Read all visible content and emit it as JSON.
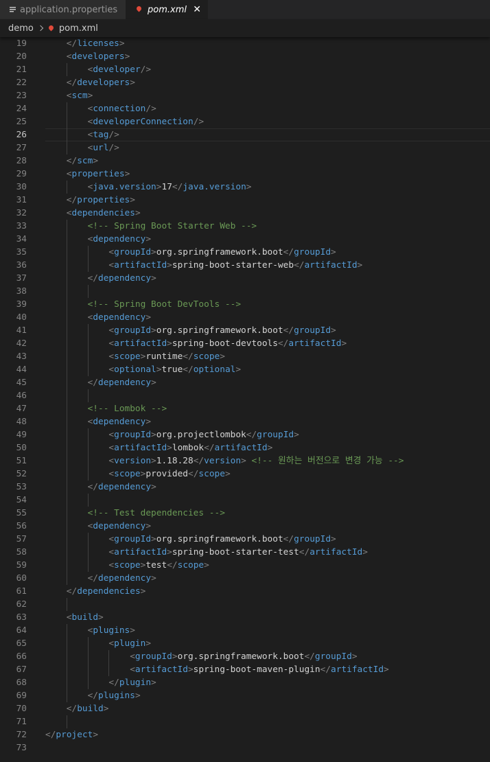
{
  "tabs": [
    {
      "label": "application.properties",
      "icon": "lines-icon",
      "active": false
    },
    {
      "label": "pom.xml",
      "icon": "xml-pin-icon",
      "active": true,
      "close": "✕"
    }
  ],
  "breadcrumb": {
    "folder": "demo",
    "file": "pom.xml"
  },
  "editor": {
    "current_line": 26,
    "colors": {
      "background": "#1e1e1e",
      "tag": "#569cd6",
      "punctuation": "#808080",
      "text": "#d4d4d4",
      "comment": "#6a9955",
      "line_number": "#858585"
    },
    "lines": [
      {
        "n": "19",
        "indent": 1,
        "tokens": [
          [
            "p",
            "</"
          ],
          [
            "t",
            "licenses"
          ],
          [
            "p",
            ">"
          ]
        ]
      },
      {
        "n": "20",
        "indent": 1,
        "tokens": [
          [
            "p",
            "<"
          ],
          [
            "t",
            "developers"
          ],
          [
            "p",
            ">"
          ]
        ]
      },
      {
        "n": "21",
        "indent": 2,
        "tokens": [
          [
            "p",
            "<"
          ],
          [
            "t",
            "developer"
          ],
          [
            "p",
            "/>"
          ]
        ]
      },
      {
        "n": "22",
        "indent": 1,
        "tokens": [
          [
            "p",
            "</"
          ],
          [
            "t",
            "developers"
          ],
          [
            "p",
            ">"
          ]
        ]
      },
      {
        "n": "23",
        "indent": 1,
        "tokens": [
          [
            "p",
            "<"
          ],
          [
            "t",
            "scm"
          ],
          [
            "p",
            ">"
          ]
        ]
      },
      {
        "n": "24",
        "indent": 2,
        "tokens": [
          [
            "p",
            "<"
          ],
          [
            "t",
            "connection"
          ],
          [
            "p",
            "/>"
          ]
        ]
      },
      {
        "n": "25",
        "indent": 2,
        "tokens": [
          [
            "p",
            "<"
          ],
          [
            "t",
            "developerConnection"
          ],
          [
            "p",
            "/>"
          ]
        ]
      },
      {
        "n": "26",
        "indent": 2,
        "tokens": [
          [
            "p",
            "<"
          ],
          [
            "t",
            "tag"
          ],
          [
            "p",
            "/>"
          ]
        ]
      },
      {
        "n": "27",
        "indent": 2,
        "tokens": [
          [
            "p",
            "<"
          ],
          [
            "t",
            "url"
          ],
          [
            "p",
            "/>"
          ]
        ]
      },
      {
        "n": "28",
        "indent": 1,
        "tokens": [
          [
            "p",
            "</"
          ],
          [
            "t",
            "scm"
          ],
          [
            "p",
            ">"
          ]
        ]
      },
      {
        "n": "29",
        "indent": 1,
        "tokens": [
          [
            "p",
            "<"
          ],
          [
            "t",
            "properties"
          ],
          [
            "p",
            ">"
          ]
        ]
      },
      {
        "n": "30",
        "indent": 2,
        "tokens": [
          [
            "p",
            "<"
          ],
          [
            "t",
            "java.version"
          ],
          [
            "p",
            ">"
          ],
          [
            "x",
            "17"
          ],
          [
            "p",
            "</"
          ],
          [
            "t",
            "java.version"
          ],
          [
            "p",
            ">"
          ]
        ]
      },
      {
        "n": "31",
        "indent": 1,
        "tokens": [
          [
            "p",
            "</"
          ],
          [
            "t",
            "properties"
          ],
          [
            "p",
            ">"
          ]
        ]
      },
      {
        "n": "32",
        "indent": 1,
        "tokens": [
          [
            "p",
            "<"
          ],
          [
            "t",
            "dependencies"
          ],
          [
            "p",
            ">"
          ]
        ]
      },
      {
        "n": "33",
        "indent": 2,
        "tokens": [
          [
            "c",
            "<!-- Spring Boot Starter Web -->"
          ]
        ]
      },
      {
        "n": "34",
        "indent": 2,
        "tokens": [
          [
            "p",
            "<"
          ],
          [
            "t",
            "dependency"
          ],
          [
            "p",
            ">"
          ]
        ]
      },
      {
        "n": "35",
        "indent": 3,
        "tokens": [
          [
            "p",
            "<"
          ],
          [
            "t",
            "groupId"
          ],
          [
            "p",
            ">"
          ],
          [
            "x",
            "org.springframework.boot"
          ],
          [
            "p",
            "</"
          ],
          [
            "t",
            "groupId"
          ],
          [
            "p",
            ">"
          ]
        ]
      },
      {
        "n": "36",
        "indent": 3,
        "tokens": [
          [
            "p",
            "<"
          ],
          [
            "t",
            "artifactId"
          ],
          [
            "p",
            ">"
          ],
          [
            "x",
            "spring-boot-starter-web"
          ],
          [
            "p",
            "</"
          ],
          [
            "t",
            "artifactId"
          ],
          [
            "p",
            ">"
          ]
        ]
      },
      {
        "n": "37",
        "indent": 2,
        "tokens": [
          [
            "p",
            "</"
          ],
          [
            "t",
            "dependency"
          ],
          [
            "p",
            ">"
          ]
        ]
      },
      {
        "n": "38",
        "indent": 0,
        "guides": 2,
        "tokens": []
      },
      {
        "n": "39",
        "indent": 2,
        "tokens": [
          [
            "c",
            "<!-- Spring Boot DevTools -->"
          ]
        ]
      },
      {
        "n": "40",
        "indent": 2,
        "tokens": [
          [
            "p",
            "<"
          ],
          [
            "t",
            "dependency"
          ],
          [
            "p",
            ">"
          ]
        ]
      },
      {
        "n": "41",
        "indent": 3,
        "tokens": [
          [
            "p",
            "<"
          ],
          [
            "t",
            "groupId"
          ],
          [
            "p",
            ">"
          ],
          [
            "x",
            "org.springframework.boot"
          ],
          [
            "p",
            "</"
          ],
          [
            "t",
            "groupId"
          ],
          [
            "p",
            ">"
          ]
        ]
      },
      {
        "n": "42",
        "indent": 3,
        "tokens": [
          [
            "p",
            "<"
          ],
          [
            "t",
            "artifactId"
          ],
          [
            "p",
            ">"
          ],
          [
            "x",
            "spring-boot-devtools"
          ],
          [
            "p",
            "</"
          ],
          [
            "t",
            "artifactId"
          ],
          [
            "p",
            ">"
          ]
        ]
      },
      {
        "n": "43",
        "indent": 3,
        "tokens": [
          [
            "p",
            "<"
          ],
          [
            "t",
            "scope"
          ],
          [
            "p",
            ">"
          ],
          [
            "x",
            "runtime"
          ],
          [
            "p",
            "</"
          ],
          [
            "t",
            "scope"
          ],
          [
            "p",
            ">"
          ]
        ]
      },
      {
        "n": "44",
        "indent": 3,
        "tokens": [
          [
            "p",
            "<"
          ],
          [
            "t",
            "optional"
          ],
          [
            "p",
            ">"
          ],
          [
            "x",
            "true"
          ],
          [
            "p",
            "</"
          ],
          [
            "t",
            "optional"
          ],
          [
            "p",
            ">"
          ]
        ]
      },
      {
        "n": "45",
        "indent": 2,
        "tokens": [
          [
            "p",
            "</"
          ],
          [
            "t",
            "dependency"
          ],
          [
            "p",
            ">"
          ]
        ]
      },
      {
        "n": "46",
        "indent": 0,
        "guides": 2,
        "tokens": []
      },
      {
        "n": "47",
        "indent": 2,
        "tokens": [
          [
            "c",
            "<!-- Lombok -->"
          ]
        ]
      },
      {
        "n": "48",
        "indent": 2,
        "tokens": [
          [
            "p",
            "<"
          ],
          [
            "t",
            "dependency"
          ],
          [
            "p",
            ">"
          ]
        ]
      },
      {
        "n": "49",
        "indent": 3,
        "tokens": [
          [
            "p",
            "<"
          ],
          [
            "t",
            "groupId"
          ],
          [
            "p",
            ">"
          ],
          [
            "x",
            "org.projectlombok"
          ],
          [
            "p",
            "</"
          ],
          [
            "t",
            "groupId"
          ],
          [
            "p",
            ">"
          ]
        ]
      },
      {
        "n": "50",
        "indent": 3,
        "tokens": [
          [
            "p",
            "<"
          ],
          [
            "t",
            "artifactId"
          ],
          [
            "p",
            ">"
          ],
          [
            "x",
            "lombok"
          ],
          [
            "p",
            "</"
          ],
          [
            "t",
            "artifactId"
          ],
          [
            "p",
            ">"
          ]
        ]
      },
      {
        "n": "51",
        "indent": 3,
        "tokens": [
          [
            "p",
            "<"
          ],
          [
            "t",
            "version"
          ],
          [
            "p",
            ">"
          ],
          [
            "x",
            "1.18.28"
          ],
          [
            "p",
            "</"
          ],
          [
            "t",
            "version"
          ],
          [
            "p",
            ">"
          ],
          [
            "x",
            " "
          ],
          [
            "c",
            "<!-- 원하는 버전으로 변경 가능 -->"
          ]
        ]
      },
      {
        "n": "52",
        "indent": 3,
        "tokens": [
          [
            "p",
            "<"
          ],
          [
            "t",
            "scope"
          ],
          [
            "p",
            ">"
          ],
          [
            "x",
            "provided"
          ],
          [
            "p",
            "</"
          ],
          [
            "t",
            "scope"
          ],
          [
            "p",
            ">"
          ]
        ]
      },
      {
        "n": "53",
        "indent": 2,
        "tokens": [
          [
            "p",
            "</"
          ],
          [
            "t",
            "dependency"
          ],
          [
            "p",
            ">"
          ]
        ]
      },
      {
        "n": "54",
        "indent": 0,
        "guides": 2,
        "tokens": []
      },
      {
        "n": "55",
        "indent": 2,
        "tokens": [
          [
            "c",
            "<!-- Test dependencies -->"
          ]
        ]
      },
      {
        "n": "56",
        "indent": 2,
        "tokens": [
          [
            "p",
            "<"
          ],
          [
            "t",
            "dependency"
          ],
          [
            "p",
            ">"
          ]
        ]
      },
      {
        "n": "57",
        "indent": 3,
        "tokens": [
          [
            "p",
            "<"
          ],
          [
            "t",
            "groupId"
          ],
          [
            "p",
            ">"
          ],
          [
            "x",
            "org.springframework.boot"
          ],
          [
            "p",
            "</"
          ],
          [
            "t",
            "groupId"
          ],
          [
            "p",
            ">"
          ]
        ]
      },
      {
        "n": "58",
        "indent": 3,
        "tokens": [
          [
            "p",
            "<"
          ],
          [
            "t",
            "artifactId"
          ],
          [
            "p",
            ">"
          ],
          [
            "x",
            "spring-boot-starter-test"
          ],
          [
            "p",
            "</"
          ],
          [
            "t",
            "artifactId"
          ],
          [
            "p",
            ">"
          ]
        ]
      },
      {
        "n": "59",
        "indent": 3,
        "tokens": [
          [
            "p",
            "<"
          ],
          [
            "t",
            "scope"
          ],
          [
            "p",
            ">"
          ],
          [
            "x",
            "test"
          ],
          [
            "p",
            "</"
          ],
          [
            "t",
            "scope"
          ],
          [
            "p",
            ">"
          ]
        ]
      },
      {
        "n": "60",
        "indent": 2,
        "tokens": [
          [
            "p",
            "</"
          ],
          [
            "t",
            "dependency"
          ],
          [
            "p",
            ">"
          ]
        ]
      },
      {
        "n": "61",
        "indent": 1,
        "tokens": [
          [
            "p",
            "</"
          ],
          [
            "t",
            "dependencies"
          ],
          [
            "p",
            ">"
          ]
        ]
      },
      {
        "n": "62",
        "indent": 0,
        "guides": 1,
        "tokens": []
      },
      {
        "n": "63",
        "indent": 1,
        "tokens": [
          [
            "p",
            "<"
          ],
          [
            "t",
            "build"
          ],
          [
            "p",
            ">"
          ]
        ]
      },
      {
        "n": "64",
        "indent": 2,
        "tokens": [
          [
            "p",
            "<"
          ],
          [
            "t",
            "plugins"
          ],
          [
            "p",
            ">"
          ]
        ]
      },
      {
        "n": "65",
        "indent": 3,
        "tokens": [
          [
            "p",
            "<"
          ],
          [
            "t",
            "plugin"
          ],
          [
            "p",
            ">"
          ]
        ]
      },
      {
        "n": "66",
        "indent": 4,
        "tokens": [
          [
            "p",
            "<"
          ],
          [
            "t",
            "groupId"
          ],
          [
            "p",
            ">"
          ],
          [
            "x",
            "org.springframework.boot"
          ],
          [
            "p",
            "</"
          ],
          [
            "t",
            "groupId"
          ],
          [
            "p",
            ">"
          ]
        ]
      },
      {
        "n": "67",
        "indent": 4,
        "tokens": [
          [
            "p",
            "<"
          ],
          [
            "t",
            "artifactId"
          ],
          [
            "p",
            ">"
          ],
          [
            "x",
            "spring-boot-maven-plugin"
          ],
          [
            "p",
            "</"
          ],
          [
            "t",
            "artifactId"
          ],
          [
            "p",
            ">"
          ]
        ]
      },
      {
        "n": "68",
        "indent": 3,
        "tokens": [
          [
            "p",
            "</"
          ],
          [
            "t",
            "plugin"
          ],
          [
            "p",
            ">"
          ]
        ]
      },
      {
        "n": "69",
        "indent": 2,
        "tokens": [
          [
            "p",
            "</"
          ],
          [
            "t",
            "plugins"
          ],
          [
            "p",
            ">"
          ]
        ]
      },
      {
        "n": "70",
        "indent": 1,
        "tokens": [
          [
            "p",
            "</"
          ],
          [
            "t",
            "build"
          ],
          [
            "p",
            ">"
          ]
        ]
      },
      {
        "n": "71",
        "indent": 0,
        "guides": 1,
        "tokens": []
      },
      {
        "n": "72",
        "indent": 0,
        "tokens": [
          [
            "p",
            "</"
          ],
          [
            "t",
            "project"
          ],
          [
            "p",
            ">"
          ]
        ]
      },
      {
        "n": "73",
        "indent": 0,
        "tokens": []
      }
    ]
  }
}
